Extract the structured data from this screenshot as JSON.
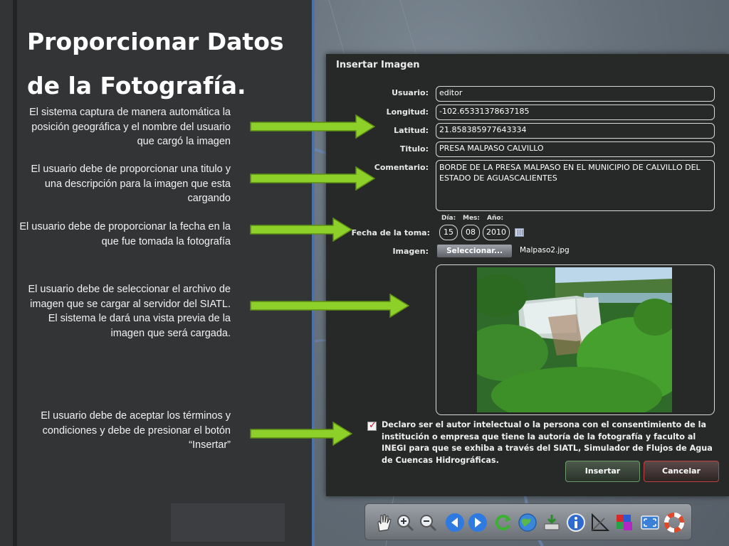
{
  "slide": {
    "title_line1": "Proporcionar Datos",
    "title_line2": "de la Fotografía.",
    "notes": [
      "El sistema captura de manera automática la posición geográfica y el nombre del usuario que cargó la imagen",
      "El usuario debe de proporcionar una titulo y una descripción para la imagen que esta cargando",
      "El usuario debe de proporcionar la fecha en la que fue tomada la fotografía",
      "El usuario debe de seleccionar el archivo de imagen que se cargar al servidor del SIATL. El sistema le dará una vista previa de la imagen que será cargada.",
      "El usuario debe de aceptar los términos y condiciones y debe de presionar el botón “Insertar”"
    ]
  },
  "dialog": {
    "title": "Insertar Imagen",
    "fields": {
      "usuario": {
        "label": "Usuario:",
        "value": "editor"
      },
      "longitud": {
        "label": "Longitud:",
        "value": "-102.65331378637185"
      },
      "latitud": {
        "label": "Latitud:",
        "value": "21.858385977643334"
      },
      "titulo": {
        "label": "Titulo:",
        "value": "PRESA MALPASO CALVILLO"
      },
      "comentario": {
        "label": "Comentario:",
        "value": "BORDE DE LA PRESA MALPASO EN EL MUNICIPIO DE CALVILLO DEL ESTADO DE AGUASCALIENTES"
      }
    },
    "date": {
      "label": "Fecha de la toma:",
      "day_label": "Día:",
      "month_label": "Mes:",
      "year_label": "Año:",
      "day": "15",
      "month": "08",
      "year": "2010"
    },
    "image": {
      "label": "Imagen:",
      "select_label": "Seleccionar...",
      "filename": "Malpaso2.jpg"
    },
    "terms": "Declaro ser el autor intelectual o la persona con el consentimiento de la institución o empresa que tiene la autoría de la fotografía y faculto al INEGI para que se exhiba a través del SIATL, Simulador de Flujos de Agua de Cuencas Hidrográficas.",
    "terms_checked": true,
    "insert_label": "Insertar",
    "cancel_label": "Cancelar"
  },
  "toolbar": {
    "icons": [
      "hand-pan-icon",
      "zoom-in-icon",
      "zoom-out-icon",
      "back-arrow-icon",
      "forward-arrow-icon",
      "refresh-icon",
      "globe-icon",
      "download-icon",
      "info-icon",
      "measure-icon",
      "3d-icon",
      "fullscreen-icon",
      "help-lifebuoy-icon"
    ]
  },
  "colors": {
    "arrow": "#8ed02a",
    "dialog_bg": "#272828",
    "accent_divider": "#4d72a8",
    "insert_border": "#6a9c6a",
    "cancel_border": "#c04040"
  }
}
